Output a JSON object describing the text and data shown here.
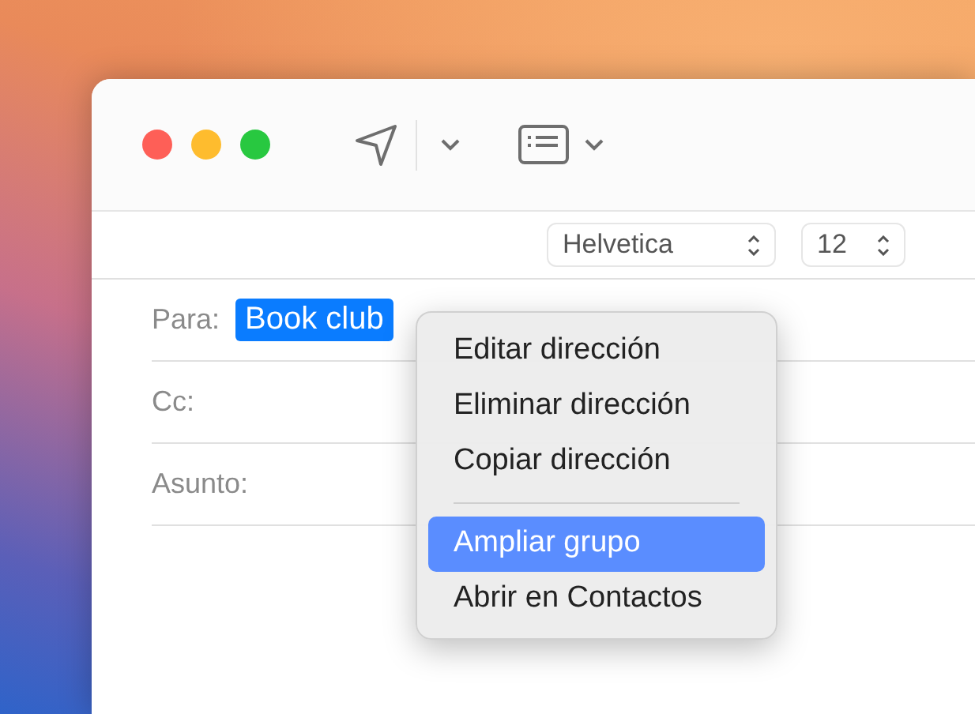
{
  "format_bar": {
    "font": "Helvetica",
    "size": "12"
  },
  "fields": [
    {
      "label": "Para:",
      "tokens": [
        {
          "text": "Book club",
          "selected": true
        }
      ]
    },
    {
      "label": "Cc:"
    },
    {
      "label": "Asunto:"
    }
  ],
  "context_menu": {
    "items": [
      {
        "kind": "item",
        "label": "Editar dirección",
        "selected": false
      },
      {
        "kind": "item",
        "label": "Eliminar dirección",
        "selected": false
      },
      {
        "kind": "item",
        "label": "Copiar dirección",
        "selected": false
      },
      {
        "kind": "separator"
      },
      {
        "kind": "item",
        "label": "Ampliar grupo",
        "selected": true
      },
      {
        "kind": "item",
        "label": "Abrir en Contactos",
        "selected": false
      }
    ]
  }
}
